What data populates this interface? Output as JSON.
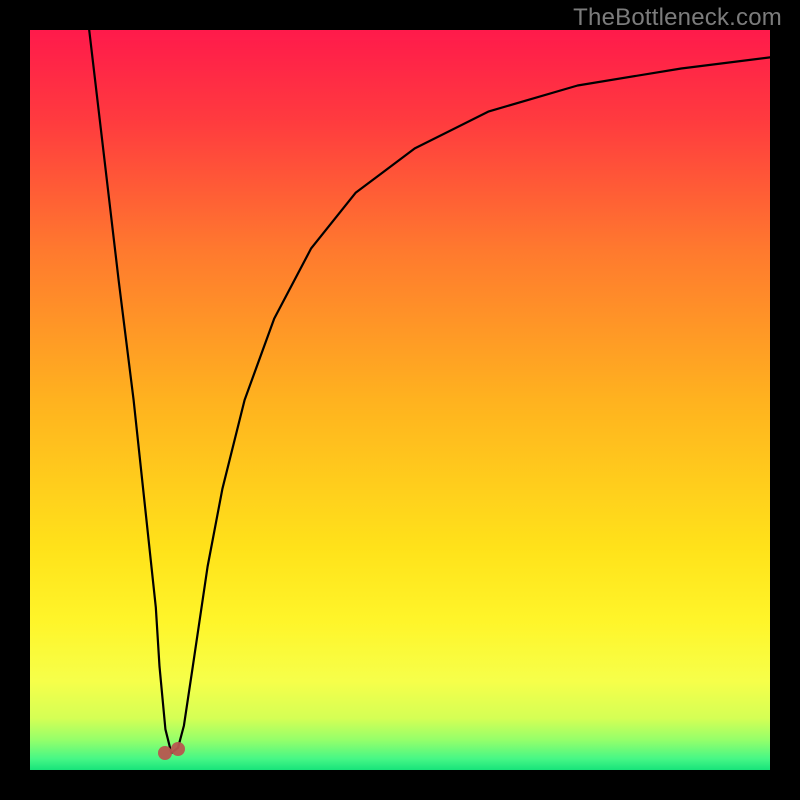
{
  "watermark": {
    "text": "TheBottleneck.com"
  },
  "colors": {
    "frame": "#000000",
    "curve_stroke": "#000000",
    "marker_fill": "#b7564f",
    "gradient_stops": [
      {
        "offset": 0.0,
        "color": "#ff1a4b"
      },
      {
        "offset": 0.12,
        "color": "#ff3a3f"
      },
      {
        "offset": 0.3,
        "color": "#ff7a2e"
      },
      {
        "offset": 0.5,
        "color": "#ffb21f"
      },
      {
        "offset": 0.7,
        "color": "#ffe21a"
      },
      {
        "offset": 0.8,
        "color": "#fff52a"
      },
      {
        "offset": 0.88,
        "color": "#f6ff4a"
      },
      {
        "offset": 0.93,
        "color": "#d5ff55"
      },
      {
        "offset": 0.96,
        "color": "#93ff6b"
      },
      {
        "offset": 0.985,
        "color": "#46f786"
      },
      {
        "offset": 1.0,
        "color": "#18e37a"
      }
    ]
  },
  "chart_data": {
    "type": "line",
    "title": "",
    "xlabel": "",
    "ylabel": "",
    "x_range": [
      0,
      100
    ],
    "y_range": [
      0,
      100
    ],
    "series": [
      {
        "name": "bottleneck-curve",
        "x": [
          8,
          10,
          12,
          14,
          15.5,
          17,
          17.5,
          18.3,
          19.1,
          20,
          20.8,
          22,
          24,
          26,
          29,
          33,
          38,
          44,
          52,
          62,
          74,
          88,
          100
        ],
        "values": [
          100,
          83,
          66,
          50,
          36,
          22,
          14,
          5.5,
          2.3,
          3.0,
          6,
          14,
          27.5,
          38,
          50,
          61,
          70.5,
          78,
          84,
          89,
          92.5,
          94.8,
          96.3
        ]
      }
    ],
    "markers": [
      {
        "name": "min-left",
        "x": 18.3,
        "y": 2.3
      },
      {
        "name": "min-right",
        "x": 20.0,
        "y": 2.9
      }
    ],
    "annotations": []
  }
}
